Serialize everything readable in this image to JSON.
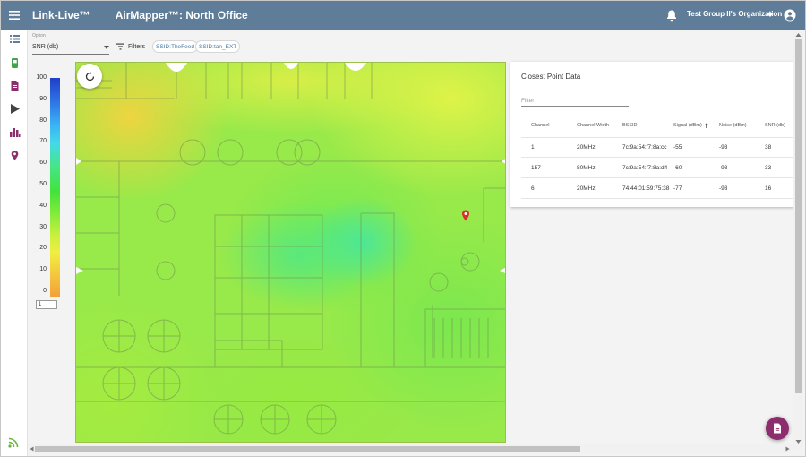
{
  "app": {
    "brand": "Link-Live™",
    "page_title": "AirMapper™: North Office",
    "organization": "Test Group II's Organization"
  },
  "controls": {
    "option_label": "Option",
    "option_value": "SNR (db)",
    "filters_label": "Filters",
    "chips": [
      "SSID:TheFeed",
      "SSID:tan_EXT"
    ]
  },
  "legend": {
    "ticks": [
      "100",
      "90",
      "80",
      "70",
      "60",
      "50",
      "40",
      "30",
      "20",
      "10",
      "0"
    ],
    "input_value": "1"
  },
  "panel": {
    "title": "Closest Point Data",
    "filter_placeholder": "Filter",
    "columns": [
      "Channel",
      "Channel Width",
      "BSSID",
      "Signal (dBm)",
      "Noise (dBm)",
      "SNR (db)"
    ],
    "sort_column": "Signal (dBm)",
    "sort_direction": "ascending",
    "rows": [
      {
        "channel": "1",
        "width": "20MHz",
        "bssid": "7c:9a:54:f7:8a:cc",
        "signal": "-55",
        "noise": "-93",
        "snr": "38"
      },
      {
        "channel": "157",
        "width": "80MHz",
        "bssid": "7c:9a:54:f7:8a:d4",
        "signal": "-60",
        "noise": "-93",
        "snr": "33"
      },
      {
        "channel": "6",
        "width": "20MHz",
        "bssid": "74:44:01:59:75:38",
        "signal": "-77",
        "noise": "-93",
        "snr": "16"
      }
    ]
  },
  "icons": {
    "topbar": [
      "menu-icon",
      "bell-icon",
      "caret-down-icon",
      "account-icon"
    ],
    "rail": [
      "list-icon",
      "device-icon",
      "document-icon",
      "play-icon",
      "bar-chart-icon",
      "map-pin-icon",
      "rss-icon"
    ],
    "map": [
      "refresh-icon",
      "map-pin-icon"
    ],
    "fab": "report-icon"
  },
  "colors": {
    "topbar": "#5f7d99",
    "chip_text": "#4a78a4",
    "fab": "#8e2d6d",
    "pin": "#d9302c"
  }
}
